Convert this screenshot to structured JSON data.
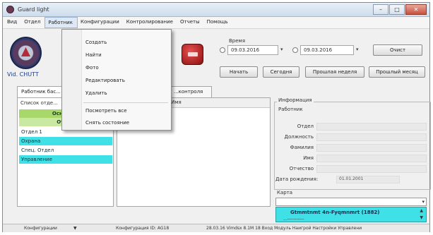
{
  "window": {
    "title": "Guard light"
  },
  "titlebar_buttons": {
    "minimize": "–",
    "maximize": "□",
    "close": "✕"
  },
  "menu": [
    "Вид",
    "Отдел",
    "Работник",
    "Конфигурации",
    "Контролирование",
    "Отчеты",
    "Помощь"
  ],
  "dropdown": {
    "items": [
      "Создать",
      "Найти",
      "Фото",
      "Редактировать",
      "Удалить"
    ],
    "items2": [
      "Посмотреть все",
      "Снять состояние"
    ]
  },
  "logo": {
    "text": "Vid. CHUTT"
  },
  "filter": {
    "group_label": "Время",
    "date_from": "09.03.2016",
    "date_to": "09.03.2016",
    "dropdown_arrow": "▾",
    "btn_clear": "Очист",
    "btn_create": "Начать",
    "btn_today": "Сегодня",
    "btn_prev": "Прошлая неделя",
    "btn_month": "Прошлый месяц"
  },
  "tabs": [
    "Работник бас...",
    "...контроля"
  ],
  "left_panel": {
    "title": "Список отде...",
    "header1": "Основная",
    "header2": "Отдел",
    "items": [
      "Отдел 1",
      "Охрана",
      "Спец. Отдел",
      "Управление"
    ]
  },
  "middle_panel": {
    "header": "Имя"
  },
  "info": {
    "title": "Информация",
    "subtitle": "Работник",
    "labels": [
      "Отдел",
      "Должность",
      "Фамилия",
      "Имя",
      "Отчество"
    ],
    "birth_label": "Дата рождения:",
    "birth_value": "01.01.2001",
    "combo_label": "Карта"
  },
  "bottom_list": {
    "row1": "Gtmmtnmt 4n-Fyqmnmrt (1882)",
    "row2": "...-----------"
  },
  "status": {
    "config": "Конфигурации",
    "arrow": "▼",
    "center": "Конфигурация ID: AG18",
    "right": "28.03.16  Vimdsx 8.1M 18  Вход Модуль Наигрой Настройки  Управлени"
  },
  "colors": {
    "accent_teal": "#3fe0e6",
    "header_green": "#9ad25c",
    "menu_highlight": "#dfe9f5"
  }
}
